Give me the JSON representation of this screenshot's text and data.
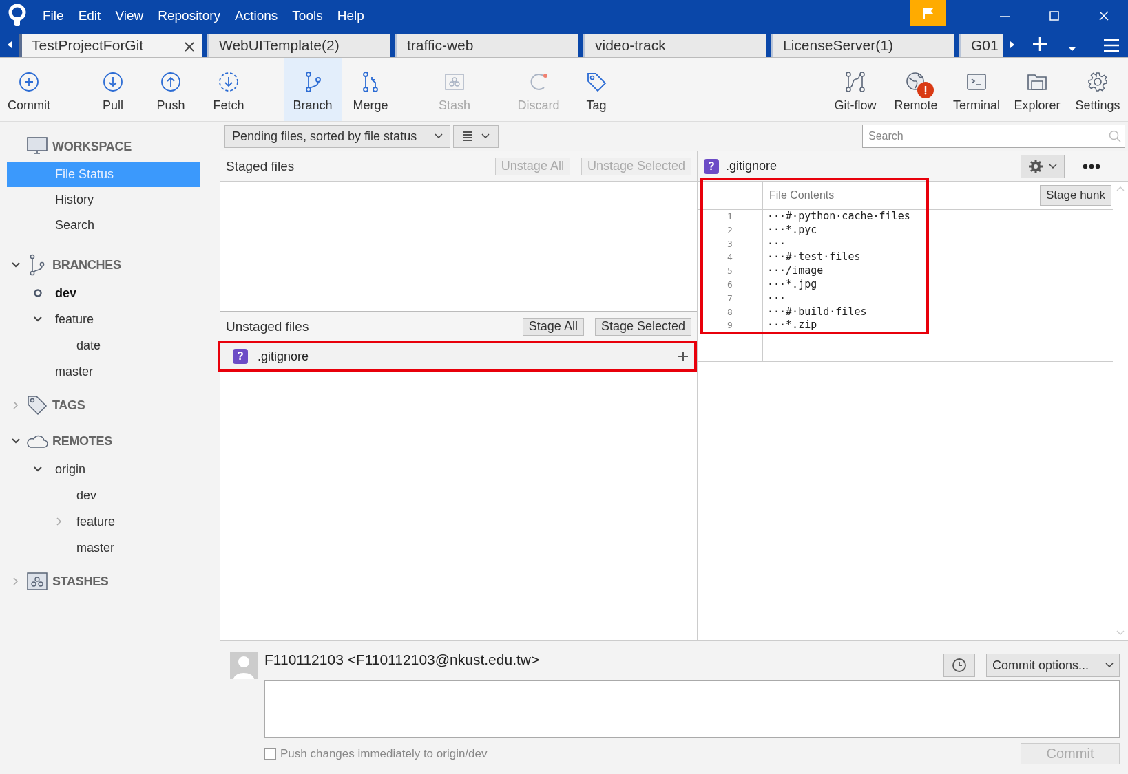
{
  "window": {
    "menu": [
      "File",
      "Edit",
      "View",
      "Repository",
      "Actions",
      "Tools",
      "Help"
    ]
  },
  "tabs": [
    {
      "label": "TestProjectForGit",
      "selected": true
    },
    {
      "label": "WebUITemplate(2)",
      "selected": false
    },
    {
      "label": "traffic-web",
      "selected": false
    },
    {
      "label": "video-track",
      "selected": false
    },
    {
      "label": "LicenseServer(1)",
      "selected": false
    },
    {
      "label": "G01",
      "selected": false
    }
  ],
  "toolbar": {
    "left": [
      {
        "label": "Commit",
        "disabled": false,
        "selected": false
      },
      {
        "label": "Pull",
        "disabled": false,
        "selected": false
      },
      {
        "label": "Push",
        "disabled": false,
        "selected": false
      },
      {
        "label": "Fetch",
        "disabled": false,
        "selected": false
      },
      {
        "label": "Branch",
        "disabled": false,
        "selected": true
      },
      {
        "label": "Merge",
        "disabled": false,
        "selected": false
      },
      {
        "label": "Stash",
        "disabled": true,
        "selected": false
      },
      {
        "label": "Discard",
        "disabled": true,
        "selected": false
      },
      {
        "label": "Tag",
        "disabled": false,
        "selected": false
      }
    ],
    "right": [
      {
        "label": "Git-flow",
        "alert": false
      },
      {
        "label": "Remote",
        "alert": true
      },
      {
        "label": "Terminal",
        "alert": false
      },
      {
        "label": "Explorer",
        "alert": false
      },
      {
        "label": "Settings",
        "alert": false
      }
    ]
  },
  "sidebar": [
    {
      "kind": "workspace",
      "title": "WORKSPACE",
      "items": [
        {
          "label": "File Status",
          "selected": true
        },
        {
          "label": "History",
          "selected": false
        },
        {
          "label": "Search",
          "selected": false
        }
      ]
    },
    {
      "kind": "branches",
      "title": "BRANCHES",
      "expanded": true,
      "items": [
        {
          "label": "dev",
          "current": true
        },
        {
          "label": "feature",
          "current": false,
          "expanded": true,
          "children": [
            {
              "label": "date",
              "current": false
            }
          ]
        },
        {
          "label": "master",
          "current": false
        }
      ]
    },
    {
      "kind": "tags",
      "title": "TAGS",
      "expanded": false
    },
    {
      "kind": "remotes",
      "title": "REMOTES",
      "expanded": true,
      "items": [
        {
          "label": "origin",
          "expanded": true,
          "children": [
            {
              "label": "dev"
            },
            {
              "label": "feature",
              "expanded": false
            },
            {
              "label": "master"
            }
          ]
        }
      ]
    },
    {
      "kind": "stashes",
      "title": "STASHES",
      "expanded": false
    }
  ],
  "filter": {
    "mode": "Pending files, sorted by file status",
    "search_placeholder": "Search"
  },
  "staged": {
    "title": "Staged files",
    "buttons": [
      {
        "label": "Unstage All",
        "disabled": true
      },
      {
        "label": "Unstage Selected",
        "disabled": true
      }
    ]
  },
  "unstaged": {
    "title": "Unstaged files",
    "buttons": [
      {
        "label": "Stage All",
        "disabled": false
      },
      {
        "label": "Stage Selected",
        "disabled": false
      }
    ],
    "files": [
      {
        "name": ".gitignore",
        "status": "?",
        "highlighted": true
      }
    ]
  },
  "diff": {
    "file": {
      "name": ".gitignore",
      "status": "?"
    },
    "header": "File Contents",
    "hunk_button": "Stage hunk",
    "highlighted": true,
    "lines": [
      {
        "number": "1",
        "text": "···#·python·cache·files"
      },
      {
        "number": "2",
        "text": "···*.pyc"
      },
      {
        "number": "3",
        "text": "···"
      },
      {
        "number": "4",
        "text": "···#·test·files"
      },
      {
        "number": "5",
        "text": "···/image"
      },
      {
        "number": "6",
        "text": "···*.jpg"
      },
      {
        "number": "7",
        "text": "···"
      },
      {
        "number": "8",
        "text": "···#·build·files"
      },
      {
        "number": "9",
        "text": "···*.zip"
      }
    ]
  },
  "commit": {
    "author": "F110112103 <F110112103@nkust.edu.tw>",
    "options": "Commit options...",
    "push_label": "Push changes immediately to origin/dev",
    "push_checked": false,
    "button": "Commit",
    "button_disabled": true
  }
}
